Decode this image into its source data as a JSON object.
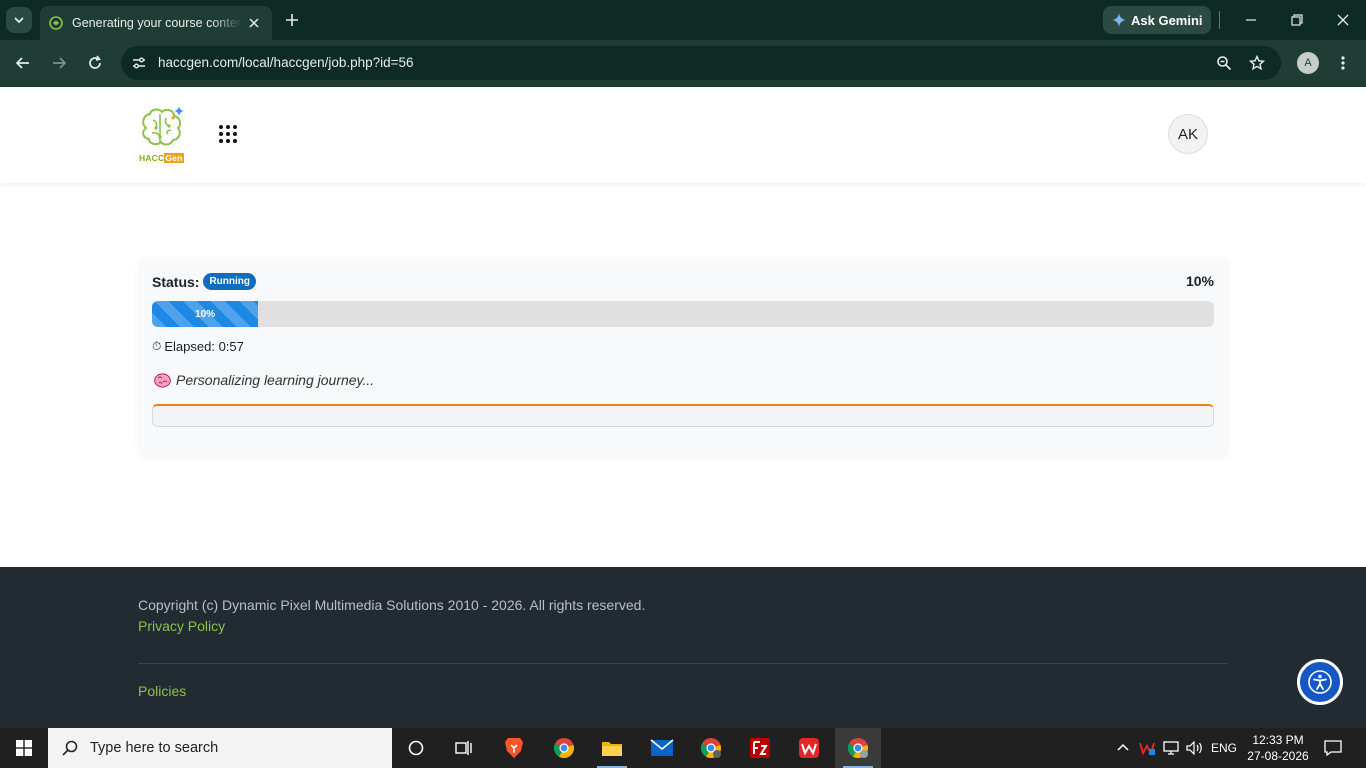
{
  "browser": {
    "tab_title": "Generating your course content",
    "url": "haccgen.com/local/haccgen/job.php?id=56",
    "gemini_label": "Ask Gemini",
    "profile_initial": "A"
  },
  "header": {
    "logo_text_hacc": "HACC",
    "logo_text_gen": "Gen",
    "user_initials": "AK"
  },
  "job": {
    "status_label": "Status:",
    "status_badge": "Running",
    "percent_label": "10%",
    "progress_percent": 10,
    "progress_text": "10%",
    "elapsed_label": "Elapsed: 0:57",
    "current_step": "Personalizing learning journey..."
  },
  "footer": {
    "copyright": "Copyright (c) Dynamic Pixel Multimedia Solutions 2010 - 2026. All rights reserved.",
    "privacy_link": "Privacy Policy",
    "policies_link": "Policies"
  },
  "taskbar": {
    "search_placeholder": "Type here to search",
    "language": "ENG",
    "time": "12:33 PM",
    "date": "27-08-2026"
  },
  "colors": {
    "browser_frame": "#0e2a24",
    "browser_toolbar": "#1f3d35",
    "badge_blue": "#0f6cbf",
    "progress_blue": "#1e88e5",
    "log_accent_orange": "#e8841a",
    "footer_bg": "#232b32",
    "footer_link_green": "#8bc34a",
    "a11y_blue": "#1657c6"
  },
  "icons": [
    "chevron-down-icon",
    "tab-favicon-icon",
    "close-icon",
    "plus-icon",
    "gemini-sparkle-icon",
    "minimize-icon",
    "restore-icon",
    "back-arrow-icon",
    "forward-arrow-icon",
    "reload-icon",
    "site-settings-icon",
    "zoom-icon",
    "star-icon",
    "kebab-menu-icon",
    "brain-logo-icon",
    "apps-grid-icon",
    "stopwatch-icon",
    "brain-emoji-icon",
    "accessibility-icon",
    "windows-start-icon",
    "search-icon",
    "cortana-icon",
    "task-view-icon",
    "brave-icon",
    "chrome-icon",
    "file-explorer-icon",
    "mail-icon",
    "filezilla-icon",
    "wps-office-icon",
    "notification-icon"
  ]
}
